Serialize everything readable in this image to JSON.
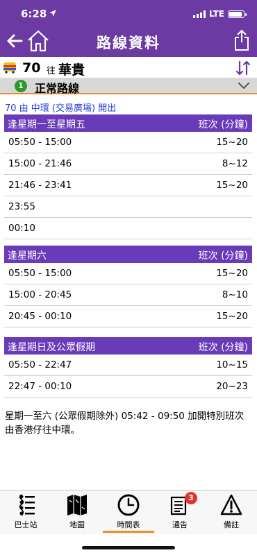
{
  "status": {
    "time": "6:28",
    "network": "LTE",
    "battery_level": 0.9
  },
  "nav": {
    "title": "路線資料"
  },
  "route": {
    "number": "70",
    "to_prefix": "往",
    "destination": "華貴"
  },
  "variant": {
    "index": "1",
    "label": "正常路線"
  },
  "departure_note": "70 由 中環 (交易廣場) 開出",
  "frequency_header": "班次 (分鐘)",
  "sections": [
    {
      "title": "逢星期一至星期五",
      "rows": [
        {
          "period": "05:50 - 15:00",
          "freq": "15~20"
        },
        {
          "period": "15:00 - 21:46",
          "freq": "8~12"
        },
        {
          "period": "21:46 - 23:41",
          "freq": "15~20"
        },
        {
          "period": "23:55",
          "freq": ""
        },
        {
          "period": "00:10",
          "freq": ""
        }
      ]
    },
    {
      "title": "逢星期六",
      "rows": [
        {
          "period": "05:50 - 15:00",
          "freq": "15~20"
        },
        {
          "period": "15:00 - 20:45",
          "freq": "8~10"
        },
        {
          "period": "20:45 - 00:10",
          "freq": "15~20"
        }
      ]
    },
    {
      "title": "逢星期日及公眾假期",
      "rows": [
        {
          "period": "05:50 - 22:47",
          "freq": "10~15"
        },
        {
          "period": "22:47 - 00:10",
          "freq": "20~23"
        }
      ]
    }
  ],
  "remark": "星期一至六 (公眾假期除外) 05:42 - 09:50 加開特別班次由香港仔往中環。",
  "tabs": [
    {
      "label": "巴士站",
      "icon": "bus-stops-icon"
    },
    {
      "label": "地圖",
      "icon": "map-icon"
    },
    {
      "label": "時間表",
      "icon": "clock-icon",
      "active": true
    },
    {
      "label": "通告",
      "icon": "notice-icon",
      "badge": "3"
    },
    {
      "label": "備註",
      "icon": "warning-icon"
    }
  ],
  "colors": {
    "header": "#6b3aa2",
    "table_header": "#6a3bb8",
    "accent": "#f08a2a",
    "link": "#1d3fd6"
  }
}
